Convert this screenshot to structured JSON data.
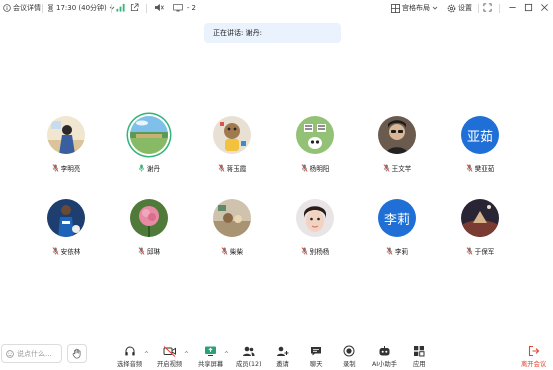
{
  "topbar": {
    "meeting_details": "会议详情",
    "time": "17:30 (40分钟)",
    "participants_count": "2",
    "layout": "宫格布局",
    "settings": "设置"
  },
  "speaking": {
    "label": "正在讲话: 谢丹:"
  },
  "participants": [
    {
      "name": "李明亮",
      "avatar": "photo",
      "mic": "muted"
    },
    {
      "name": "谢丹",
      "avatar": "photo",
      "mic": "active",
      "speaking": true
    },
    {
      "name": "蒋玉霞",
      "avatar": "photo",
      "mic": "muted"
    },
    {
      "name": "杨明阳",
      "avatar": "photo",
      "mic": "muted"
    },
    {
      "name": "王文芊",
      "avatar": "photo",
      "mic": "muted"
    },
    {
      "name": "樊亚茹",
      "avatar": "text",
      "avatar_text": "亚茹",
      "mic": "muted"
    },
    {
      "name": "安依林",
      "avatar": "photo",
      "mic": "muted"
    },
    {
      "name": "邱琳",
      "avatar": "photo",
      "mic": "muted"
    },
    {
      "name": "柴柴",
      "avatar": "photo",
      "mic": "muted"
    },
    {
      "name": "别杨杨",
      "avatar": "photo",
      "mic": "muted"
    },
    {
      "name": "李莉",
      "avatar": "text",
      "avatar_text": "李莉",
      "mic": "muted"
    },
    {
      "name": "于保军",
      "avatar": "photo",
      "mic": "muted"
    }
  ],
  "bottombar": {
    "chat_placeholder": "说点什么...",
    "select_audio": "选择音频",
    "start_video": "开启视频",
    "share_screen": "共享屏幕",
    "members": "成员(12)",
    "invite": "邀请",
    "chat": "聊天",
    "record": "录制",
    "ai_assistant": "AI小助手",
    "apps": "应用",
    "leave": "离开会议"
  },
  "colors": {
    "accent_blue": "#1f6fd6",
    "speaking_green": "#34b37a",
    "leave_red": "#e0442f",
    "muted_red": "#e8432f"
  }
}
